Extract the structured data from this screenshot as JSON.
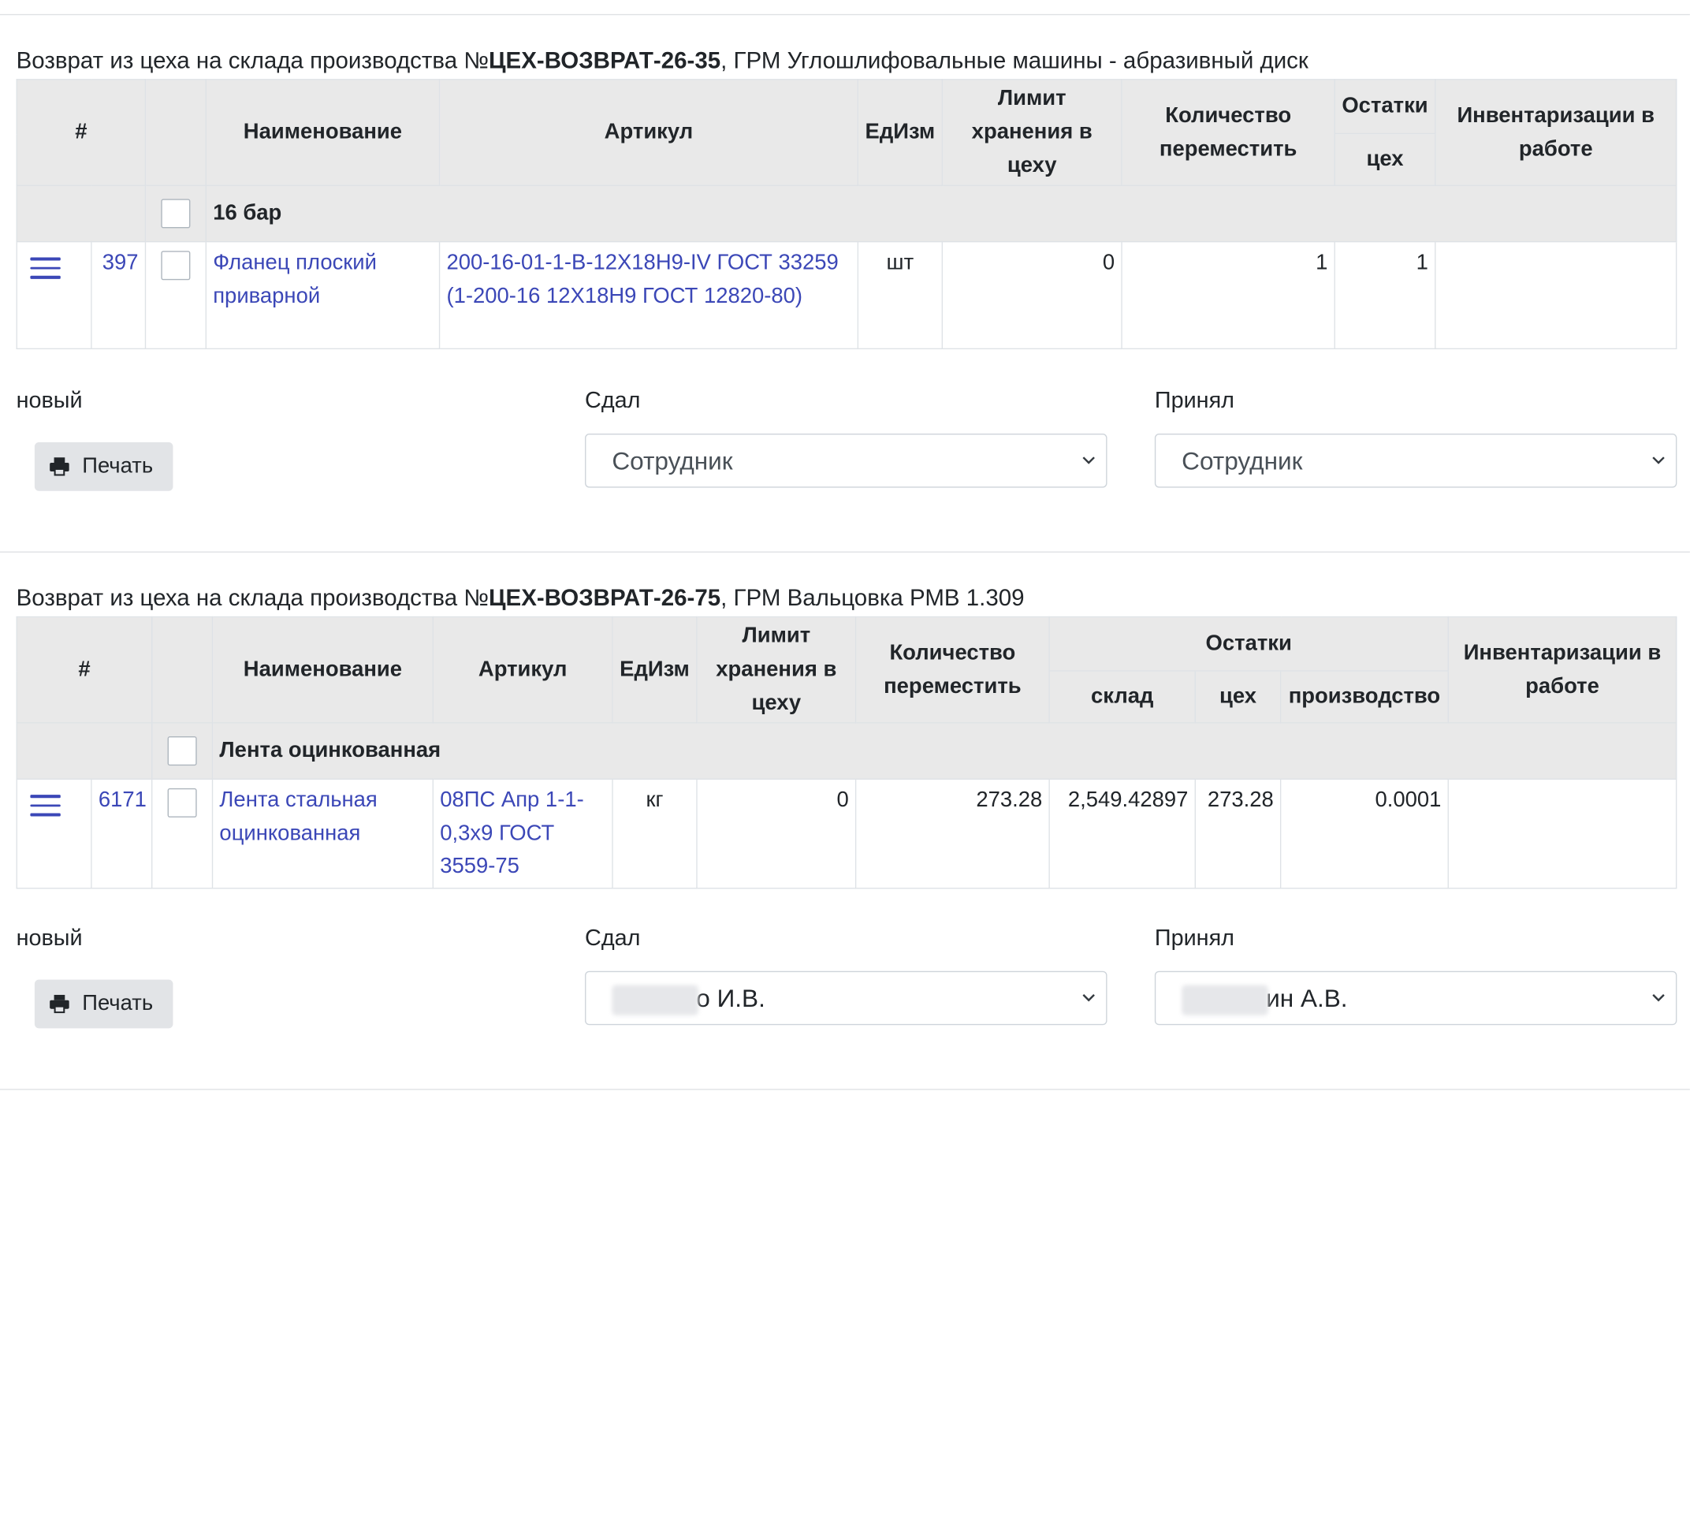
{
  "blocks": [
    {
      "title_prefix": "Возврат из цеха на склада производства №",
      "title_code": "ЦЕХ-ВОЗВРАТ-26-35",
      "title_suffix": ", ГРМ Углошлифовальные машины - абразивный диск",
      "headers": {
        "hash": "#",
        "name": "Наименование",
        "article": "Артикул",
        "unit": "ЕдИзм",
        "limit": "Лимит хранения в цеху",
        "qty": "Количество переместить",
        "stock": "Остатки",
        "stock_workshop": "цех",
        "inventory": "Инвентаризации в работе"
      },
      "group_label": "16 бар",
      "row": {
        "id": "397",
        "name": "Фланец плоский приварной",
        "article": "200-16-01-1-B-12Х18Н9-IV ГОСТ 33259 (1-200-16 12Х18Н9 ГОСТ 12820-80)",
        "unit": "шт",
        "limit": "0",
        "qty": "1",
        "stock_workshop": "1",
        "inventory": ""
      },
      "status": "новый",
      "print_label": "Печать",
      "gave_label": "Сдал",
      "received_label": "Принял",
      "gave_value": "Сотрудник",
      "received_value": "Сотрудник"
    },
    {
      "title_prefix": "Возврат из цеха на склада производства №",
      "title_code": "ЦЕХ-ВОЗВРАТ-26-75",
      "title_suffix": ", ГРМ Вальцовка РМВ 1.309",
      "headers": {
        "hash": "#",
        "name": "Наименование",
        "article": "Артикул",
        "unit": "ЕдИзм",
        "limit": "Лимит хранения в цеху",
        "qty": "Количество переместить",
        "stock": "Остатки",
        "stock_warehouse": "склад",
        "stock_workshop": "цех",
        "stock_production": "производство",
        "inventory": "Инвентаризации в работе"
      },
      "group_label": "Лента оцинкованная",
      "row": {
        "id": "6171",
        "name": "Лента стальная оцинкованная",
        "article": "08ПС Апр 1-1-0,3х9 ГОСТ 3559-75",
        "unit": "кг",
        "limit": "0",
        "qty": "273.28",
        "stock_warehouse": "2,549.42897",
        "stock_workshop": "273.28",
        "stock_production": "0.0001",
        "inventory": ""
      },
      "status": "новый",
      "print_label": "Печать",
      "gave_label": "Сдал",
      "received_label": "Принял",
      "gave_value": "о И.В.",
      "received_value": "ин А.В."
    }
  ],
  "colors": {
    "link": "#3b47b7",
    "header_bg": "#e9e9e9",
    "button_bg": "#e2e4e7"
  }
}
